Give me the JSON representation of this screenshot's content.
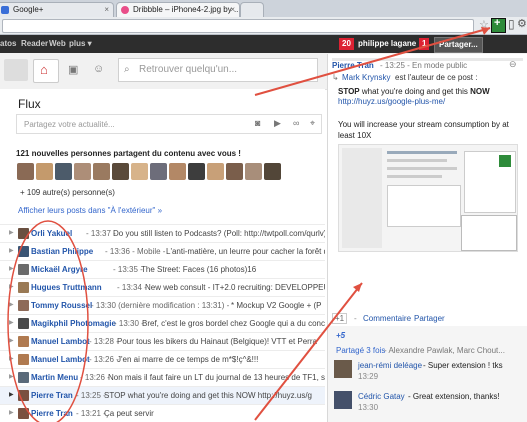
{
  "browser": {
    "tabs": [
      {
        "label": "Google+"
      },
      {
        "label": "Dribbble – iPhone4-2.jpg by ..."
      },
      {
        "label": ""
      }
    ]
  },
  "gbar": {
    "items": [
      "atos",
      "Reader",
      "Web",
      "plus ▾"
    ],
    "notif_count": "20",
    "user": "philippe lagane",
    "share_count": "1",
    "share_label": "Partager..."
  },
  "search": {
    "placeholder": "Retrouver quelqu'un..."
  },
  "stream": {
    "title": "Flux",
    "share_placeholder": "Partagez votre actualité...",
    "suggest_heading": "121 nouvelles personnes partagent du contenu avec vous !",
    "others": "+ 109 autre(s) personne(s)",
    "show_link": "Afficher leurs posts dans \"À l'extérieur\" »",
    "rows": [
      {
        "name": "Orli Yakuel",
        "meta": " - 13:37 - ",
        "text": "Do you still listen to Podcasts? (Poll: http://twtpoll.com/qurlv)"
      },
      {
        "name": "Bastian Philippe",
        "meta": " - 13:36 - Mobile - ",
        "text": "L'anti-matière, un leurre pour cacher la forêt de Bezo"
      },
      {
        "name": "Mickaël Argyre",
        "meta": " - 13:35 - ",
        "text": "The Street: Faces (16 photos)16"
      },
      {
        "name": "Hugues Truttmann",
        "meta": " - 13:34 - ",
        "text": "New web consult - IT+2.0 recruiting: DEVELOPPEUR W"
      },
      {
        "name": "Tommy Roussel",
        "meta": " - 13:30 (dernière modification : 13:31) - ",
        "text": "* Mockup V2 Google + (P"
      },
      {
        "name": "Magikphil Photomagie",
        "meta": " - 13:30 - ",
        "text": "Bref, c'est le gros bordel chez Google qui a du conc"
      },
      {
        "name": "Manuel Lambot",
        "meta": " - 13:28 - ",
        "text": "Pour tous les bikers du Hainaut (Belgique)! VTT et Perra"
      },
      {
        "name": "Manuel Lambot",
        "meta": " - 13:26 - ",
        "text": "J'en ai marre de ce temps de m*$!ç^&!!!"
      },
      {
        "name": "Martin Menu",
        "meta": " - 13:26 - ",
        "text": "Non mais il faut faire un LT du journal de 13 heures de TF1, s"
      },
      {
        "name": "Pierre Tran",
        "meta": " - 13:25 - ",
        "text": "STOP what you're doing and get this NOW http://huyz.us/g"
      },
      {
        "name": "Pierre Tran",
        "meta": " - 13:21 - ",
        "text": "Ça peut servir"
      }
    ]
  },
  "post": {
    "author": "Pierre Tran",
    "meta": "- 13:25 - En mode public",
    "reshare_name": "Mark Krynsky",
    "reshare_text": " est l'auteur de ce post :",
    "body_bold1": "STOP",
    "body_1": " what you're doing and get this ",
    "body_bold2": "NOW",
    "link": "http://huyz.us/google-plus-me/",
    "body_2": "You will increase your stream consumption by at least 10X",
    "plus_one": "+1",
    "comment_label": "Commentaire",
    "share_label": "Partager",
    "plus5": "+5",
    "shared_text": "Partagé 3 fois",
    "shared_names": " - Alexandre Pawlak, Marc Chout...",
    "comments": [
      {
        "name": "jean-rémi deléage",
        "text": " - Super extension ! tks",
        "time": "13:29"
      },
      {
        "name": "Cédric Gatay",
        "text": " - Great extension, thanks!",
        "time": "13:30"
      }
    ]
  },
  "colors": {
    "accent": "#3366cc",
    "red": "#dd2222",
    "annotation": "#e05040"
  }
}
